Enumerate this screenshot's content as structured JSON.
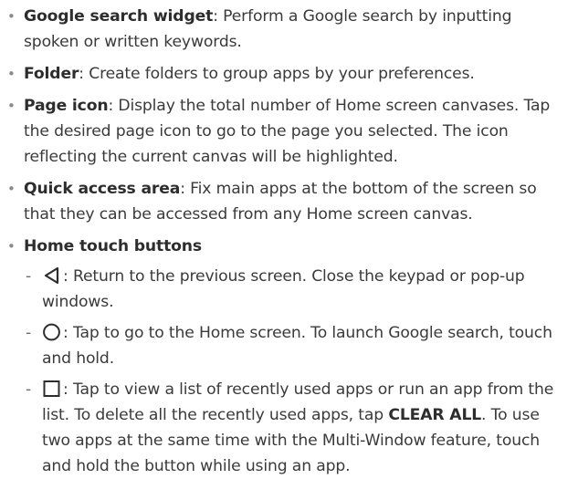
{
  "items": [
    {
      "term": "Google search widget",
      "desc": ": Perform a Google search by inputting spoken or written keywords."
    },
    {
      "term": "Folder",
      "desc": ": Create folders to group apps by your preferences."
    },
    {
      "term": "Page icon",
      "desc": ": Display the total number of Home screen canvases. Tap the desired page icon to go to the page you selected. The icon reflecting the current canvas will be highlighted."
    },
    {
      "term": "Quick access area",
      "desc": ": Fix main apps at the bottom of the screen so that they can be accessed from any Home screen canvas."
    },
    {
      "term": "Home touch buttons"
    }
  ],
  "touch_buttons": [
    {
      "icon": "back-triangle-icon",
      "text": ": Return to the previous screen. Close the keypad or pop-up windows."
    },
    {
      "icon": "home-circle-icon",
      "text": ": Tap to go to the Home screen. To launch Google search, touch and hold."
    },
    {
      "icon": "recent-apps-square-icon",
      "text_before": ": Tap to view a list of recently used apps or run an app from the list. To delete all the recently used apps, tap ",
      "strong": "CLEAR ALL",
      "text_after": ". To use two apps at the same time with the Multi-Window feature, touch and hold the button while using an app."
    }
  ],
  "colors": {
    "text": "#3a3a3a",
    "bullet": "#8a8a8a"
  }
}
